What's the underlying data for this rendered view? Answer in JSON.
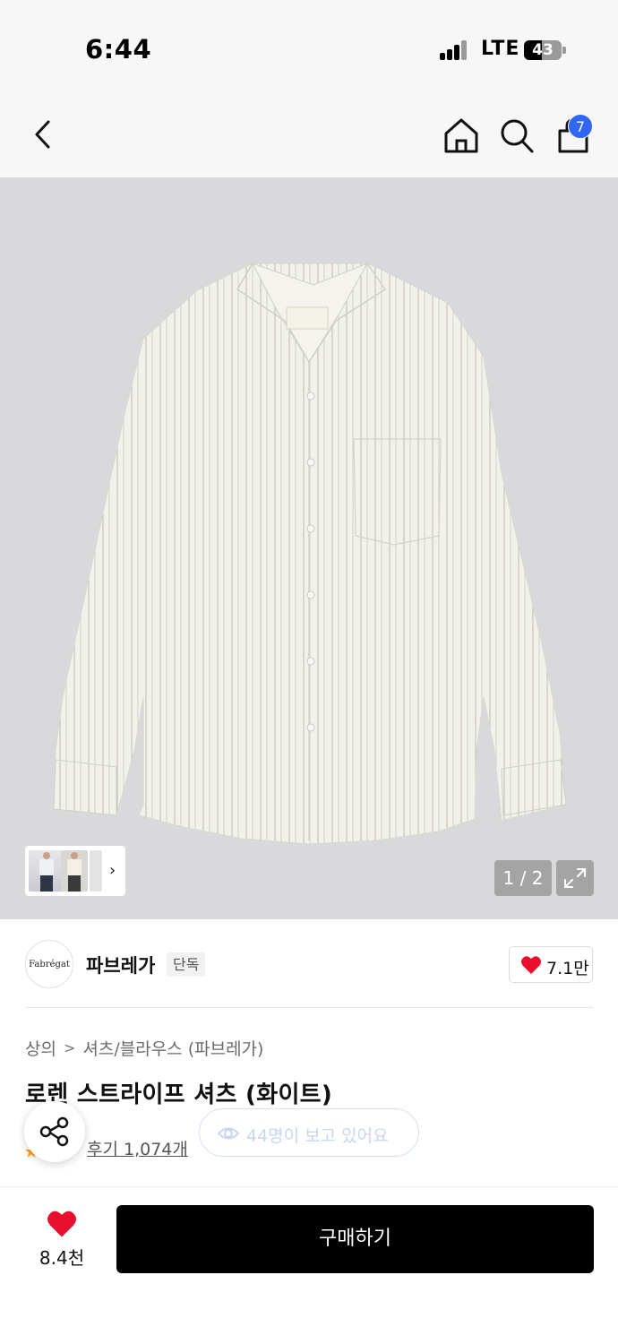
{
  "status": {
    "time": "6:44",
    "network": "LTE",
    "battery": "43"
  },
  "nav": {
    "back_icon": "chevron-left-icon",
    "home_icon": "home-icon",
    "search_icon": "search-icon",
    "cart_icon": "shopping-bag-icon",
    "cart_count": "7",
    "cart_badge_color": "#2f66f6"
  },
  "gallery": {
    "page_indicator": "1 / 2",
    "thumbnail_chevron": "›",
    "expand_icon": "expand-icon",
    "background_color": "#d9d9db"
  },
  "brand": {
    "logo_text": "Fabrégat",
    "name": "파브레가",
    "badge": "단독",
    "like_count": "7.1만",
    "heart_color": "#e8102e"
  },
  "product": {
    "breadcrumb": [
      "상의",
      "셔츠/블라우스 (파브레가)"
    ],
    "breadcrumb_separator": ">",
    "title": "로렌 스트라이프 셔츠 (화이트)",
    "review_link": "후기 1,074개",
    "viewers_text": "44명이 보고 있어요"
  },
  "bottom": {
    "wish_count": "8.4천",
    "buy_label": "구매하기"
  }
}
